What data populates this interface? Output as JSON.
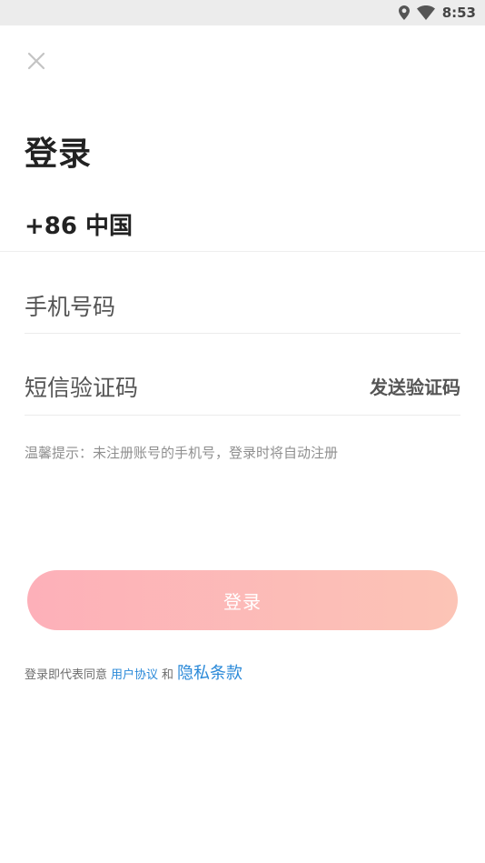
{
  "status_bar": {
    "time": "8:53",
    "icons": [
      "location-icon",
      "wifi-icon"
    ]
  },
  "login": {
    "close_icon": "close-icon",
    "title": "登录",
    "country_code": "+86 中国",
    "phone_placeholder": "手机号码",
    "code_placeholder": "短信验证码",
    "send_code_label": "发送验证码",
    "tip": "温馨提示：未注册账号的手机号，登录时将自动注册",
    "login_button_label": "登录",
    "agreement_prefix": "登录即代表同意",
    "user_agreement_link": "用户协议",
    "and_text": "和",
    "privacy_link": "隐私条款"
  },
  "colors": {
    "button_gradient_start": "#fdb0b9",
    "button_gradient_end": "#fcc4b6",
    "link": "#2a89d8",
    "status_bar_bg": "#ececec"
  }
}
